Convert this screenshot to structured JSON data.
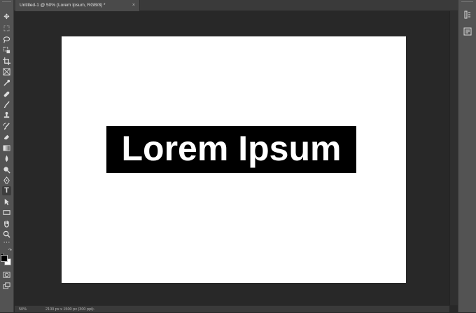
{
  "document": {
    "tab_title": "Untitled-1 @ 50% (Lorem Ipsum, RGB/8) *",
    "close_glyph": "×"
  },
  "canvas": {
    "text_layer_content": "Lorem Ipsum",
    "text_color": "#ffffff",
    "highlight_color": "#000000",
    "background_color": "#ffffff"
  },
  "status": {
    "zoom": "50%",
    "doc_info": "2100 px x 1500 px (300 ppi)",
    "arrow": "›"
  },
  "tools": [
    {
      "name": "move-tool-icon",
      "glyph": "✥"
    },
    {
      "name": "marquee-tool-icon",
      "glyph": "⬚"
    },
    {
      "name": "lasso-tool-icon",
      "glyph": "ᛃ"
    },
    {
      "name": "quick-select-tool-icon",
      "glyph": "⌖"
    },
    {
      "name": "crop-tool-icon",
      "glyph": "⌗"
    },
    {
      "name": "frame-tool-icon",
      "glyph": "⊠"
    },
    {
      "name": "eyedropper-tool-icon",
      "glyph": "⁄"
    },
    {
      "name": "healing-brush-tool-icon",
      "glyph": "✚"
    },
    {
      "name": "brush-tool-icon",
      "glyph": "⁄"
    },
    {
      "name": "clone-stamp-tool-icon",
      "glyph": "⊥"
    },
    {
      "name": "history-brush-tool-icon",
      "glyph": "↯"
    },
    {
      "name": "eraser-tool-icon",
      "glyph": "◆"
    },
    {
      "name": "gradient-tool-icon",
      "glyph": "▦"
    },
    {
      "name": "blur-tool-icon",
      "glyph": "●"
    },
    {
      "name": "dodge-tool-icon",
      "glyph": "♦"
    },
    {
      "name": "pen-tool-icon",
      "glyph": "✒"
    },
    {
      "name": "type-tool-icon",
      "glyph": "T"
    },
    {
      "name": "path-select-tool-icon",
      "glyph": "➤"
    },
    {
      "name": "rectangle-tool-icon",
      "glyph": "▭"
    },
    {
      "name": "hand-tool-icon",
      "glyph": "✋"
    },
    {
      "name": "zoom-tool-icon",
      "glyph": "⚲"
    },
    {
      "name": "edit-toolbar-icon",
      "glyph": "⋯"
    }
  ]
}
